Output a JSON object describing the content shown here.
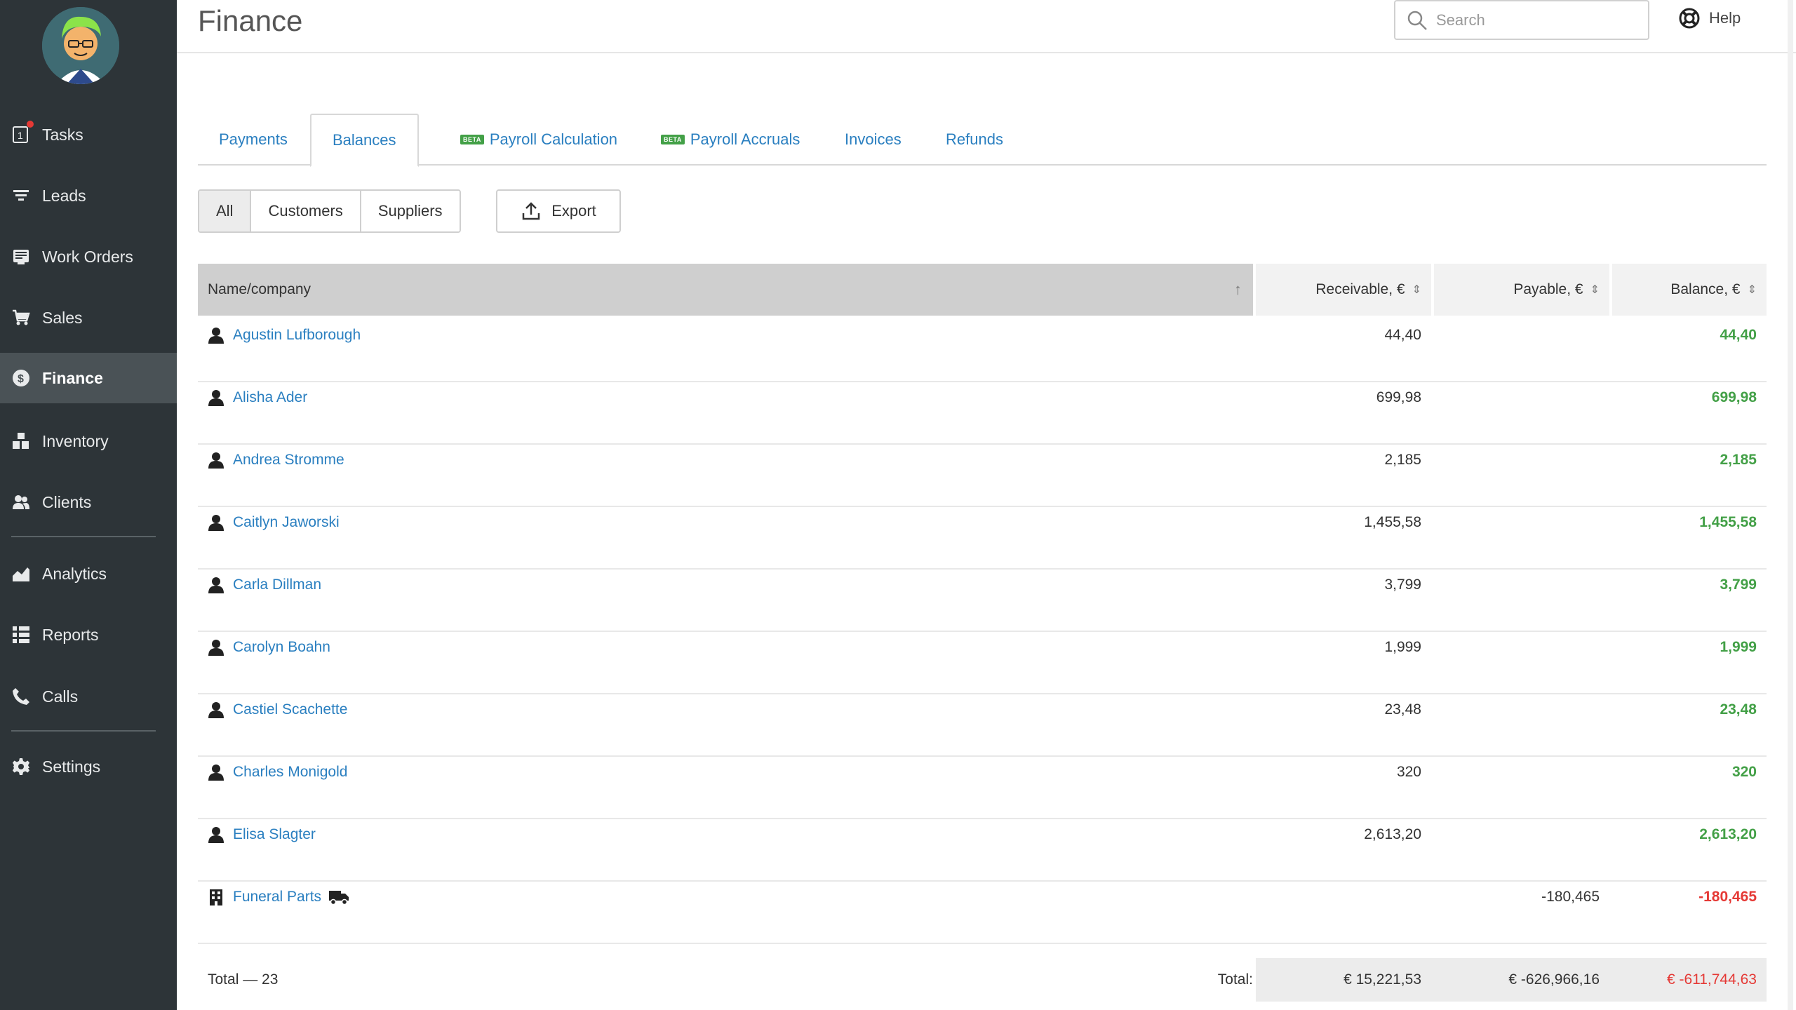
{
  "app": {
    "title": "Finance"
  },
  "sidebar": {
    "items": [
      {
        "label": "Tasks",
        "icon": "tasks-icon",
        "badge": true
      },
      {
        "label": "Leads",
        "icon": "leads-icon"
      },
      {
        "label": "Work Orders",
        "icon": "work-orders-icon"
      },
      {
        "label": "Sales",
        "icon": "cart-icon"
      },
      {
        "label": "Finance",
        "icon": "dollar-icon",
        "active": true
      },
      {
        "label": "Inventory",
        "icon": "inventory-icon"
      },
      {
        "label": "Clients",
        "icon": "clients-icon"
      },
      {
        "label": "Analytics",
        "icon": "analytics-icon"
      },
      {
        "label": "Reports",
        "icon": "reports-icon"
      },
      {
        "label": "Calls",
        "icon": "phone-icon"
      },
      {
        "label": "Settings",
        "icon": "gear-icon"
      }
    ],
    "tasks_icon_text": "1"
  },
  "header": {
    "search_placeholder": "Search",
    "help_label": "Help"
  },
  "tabs": [
    {
      "label": "Payments"
    },
    {
      "label": "Balances",
      "active": true
    },
    {
      "label": "Payroll Calculation",
      "beta": true
    },
    {
      "label": "Payroll Accruals",
      "beta": true
    },
    {
      "label": "Invoices"
    },
    {
      "label": "Refunds"
    }
  ],
  "beta_label": "BETA",
  "filters": {
    "all": "All",
    "customers": "Customers",
    "suppliers": "Suppliers",
    "export": "Export"
  },
  "table": {
    "columns": {
      "name": "Name/company",
      "receivable": "Receivable, €",
      "payable": "Payable, €",
      "balance": "Balance, €"
    },
    "rows": [
      {
        "name": "Agustin Lufborough",
        "type": "person",
        "receivable": "44,40",
        "payable": "",
        "balance": "44,40",
        "sign": "pos"
      },
      {
        "name": "Alisha Ader",
        "type": "person",
        "receivable": "699,98",
        "payable": "",
        "balance": "699,98",
        "sign": "pos"
      },
      {
        "name": "Andrea Stromme",
        "type": "person",
        "receivable": "2,185",
        "payable": "",
        "balance": "2,185",
        "sign": "pos"
      },
      {
        "name": "Caitlyn Jaworski",
        "type": "person",
        "receivable": "1,455,58",
        "payable": "",
        "balance": "1,455,58",
        "sign": "pos"
      },
      {
        "name": "Carla Dillman",
        "type": "person",
        "receivable": "3,799",
        "payable": "",
        "balance": "3,799",
        "sign": "pos"
      },
      {
        "name": "Carolyn Boahn",
        "type": "person",
        "receivable": "1,999",
        "payable": "",
        "balance": "1,999",
        "sign": "pos"
      },
      {
        "name": "Castiel Scachette",
        "type": "person",
        "receivable": "23,48",
        "payable": "",
        "balance": "23,48",
        "sign": "pos"
      },
      {
        "name": "Charles Monigold",
        "type": "person",
        "receivable": "320",
        "payable": "",
        "balance": "320",
        "sign": "pos"
      },
      {
        "name": "Elisa Slagter",
        "type": "person",
        "receivable": "2,613,20",
        "payable": "",
        "balance": "2,613,20",
        "sign": "pos"
      },
      {
        "name": "Funeral Parts",
        "type": "company",
        "supplier": true,
        "receivable": "",
        "payable": "-180,465",
        "balance": "-180,465",
        "sign": "neg"
      }
    ],
    "footer": {
      "count": "Total — 23",
      "total_label": "Total:",
      "receivable": "€ 15,221,53",
      "payable": "€ -626,966,16",
      "balance": "€ -611,744,63"
    }
  },
  "colors": {
    "sidebar_bg": "#2d3438",
    "link": "#2a7fc0",
    "positive": "#43a047",
    "negative": "#e53935"
  }
}
